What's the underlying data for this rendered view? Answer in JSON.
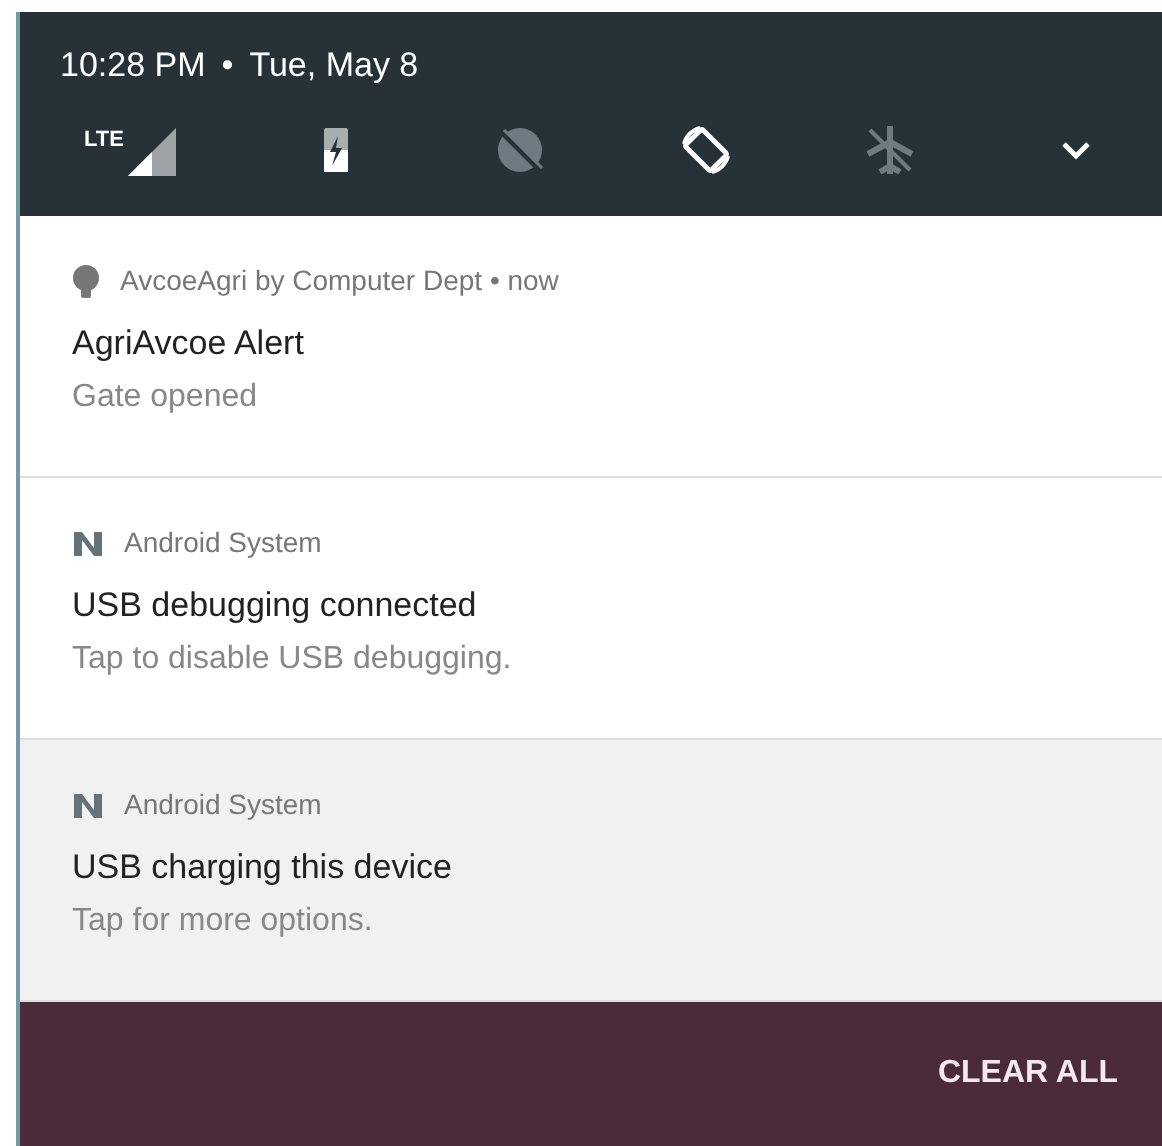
{
  "status_header": {
    "time": "10:28 PM",
    "separator": "•",
    "date": "Tue, May 8"
  },
  "quick_settings": [
    {
      "kind": "signal",
      "label": "LTE",
      "on": true
    },
    {
      "kind": "battery",
      "on": true
    },
    {
      "kind": "data-saver",
      "on": false
    },
    {
      "kind": "rotate",
      "on": true
    },
    {
      "kind": "airplane",
      "on": false
    },
    {
      "kind": "expand",
      "on": true
    }
  ],
  "notifications": [
    {
      "kind": "bulb",
      "app": "AvcoeAgri by Computer Dept • now",
      "title": "AgriAvcoe Alert",
      "text": "Gate opened",
      "shaded": false
    },
    {
      "kind": "system",
      "app": "Android System",
      "title": "USB debugging connected",
      "text": "Tap to disable USB debugging.",
      "shaded": false
    },
    {
      "kind": "system",
      "app": "Android System",
      "title": "USB charging this device",
      "text": "Tap for more options.",
      "shaded": true
    }
  ],
  "footer": {
    "button": "CLEAR ALL"
  }
}
